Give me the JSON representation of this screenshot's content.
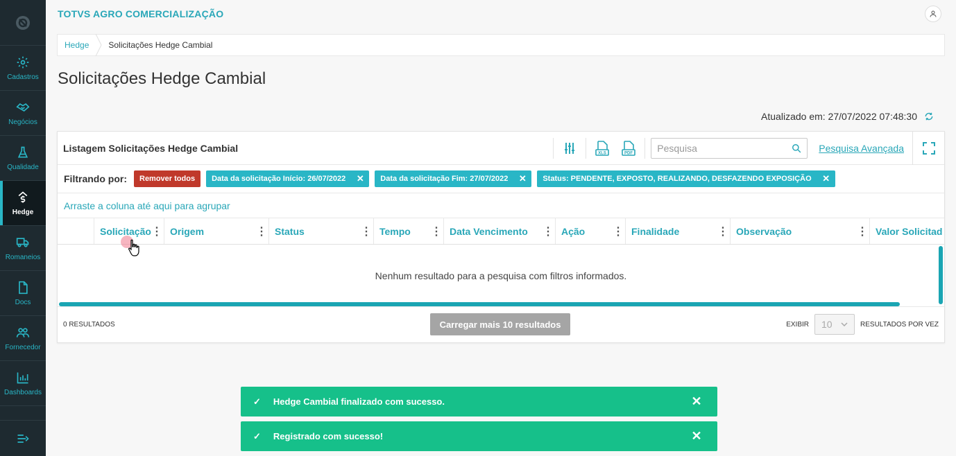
{
  "app": {
    "company": "TOTVS AGRO COMERCIALIZAÇÃO",
    "user_icon": "user-icon",
    "accent": "#29a7b8"
  },
  "sidebar": {
    "items": [
      {
        "label": "Cadastros",
        "icon": "gear-icon"
      },
      {
        "label": "Negócios",
        "icon": "handshake-icon"
      },
      {
        "label": "Qualidade",
        "icon": "flask-icon"
      },
      {
        "label": "Hedge",
        "icon": "hedge-icon",
        "active": true
      },
      {
        "label": "Romaneios",
        "icon": "truck-icon"
      },
      {
        "label": "Docs",
        "icon": "document-icon"
      },
      {
        "label": "Fornecedor",
        "icon": "users-icon"
      },
      {
        "label": "Dashboards",
        "icon": "bar-chart-icon"
      }
    ],
    "bg_color": "#1e2a30"
  },
  "breadcrumb": {
    "parent": "Hedge",
    "current": "Solicitações Hedge Cambial"
  },
  "page": {
    "title": "Solicitações Hedge Cambial",
    "updated": "Atualizado em: 27/07/2022 07:48:30"
  },
  "card": {
    "title": "Listagem Solicitações Hedge Cambial",
    "search_placeholder": "Pesquisa",
    "advanced_search": "Pesquisa Avançada"
  },
  "filters": {
    "label": "Filtrando por:",
    "remove_all": "Remover todos",
    "chips": [
      "Data da solicitação Início: 26/07/2022",
      "Data da solicitação Fim: 27/07/2022",
      "Status: PENDENTE, EXPOSTO, REALIZANDO, DESFAZENDO EXPOSIÇÃO"
    ],
    "chip_color": "#29b6c6",
    "remove_color": "#c0392b"
  },
  "grid": {
    "group_hint": "Arraste a coluna até aqui para agrupar",
    "columns": [
      "Solicitação",
      "Origem",
      "Status",
      "Tempo",
      "Data Vencimento",
      "Ação",
      "Finalidade",
      "Observação",
      "Valor Solicitad"
    ],
    "empty_message": "Nenhum resultado para a pesquisa com filtros informados."
  },
  "footer": {
    "results": "0 RESULTADOS",
    "load_more": "Carregar mais 10 resultados",
    "show_label": "EXIBIR",
    "per_page_value": "10",
    "per_page_suffix": "RESULTADOS POR VEZ"
  },
  "toasts": [
    {
      "message": "Hedge Cambial finalizado com sucesso."
    },
    {
      "message": "Registrado com sucesso!"
    }
  ],
  "toast_color": "#16c08a"
}
